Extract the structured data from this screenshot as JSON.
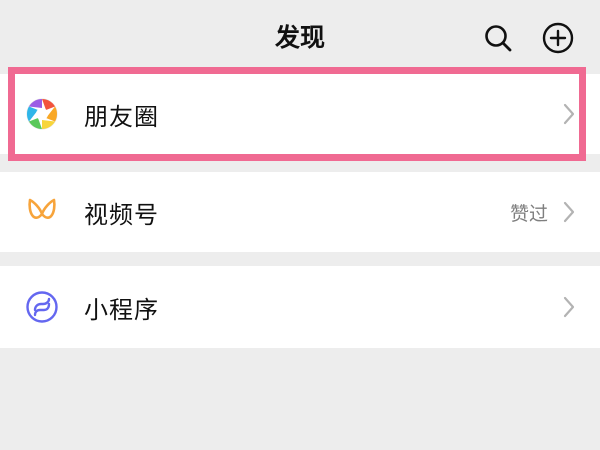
{
  "header": {
    "title": "发现",
    "search_icon": "search-icon",
    "add_icon": "add-circle-icon"
  },
  "items": [
    {
      "label": "朋友圈",
      "icon": "moments-aperture-icon",
      "extra": ""
    },
    {
      "label": "视频号",
      "icon": "channels-butterfly-icon",
      "extra": "赞过"
    },
    {
      "label": "小程序",
      "icon": "mini-program-icon",
      "extra": ""
    }
  ],
  "colors": {
    "background": "#ededed",
    "row": "#ffffff",
    "highlight": "#f06a92",
    "channels": "#f7a43b",
    "mini_program": "#6467f0"
  }
}
